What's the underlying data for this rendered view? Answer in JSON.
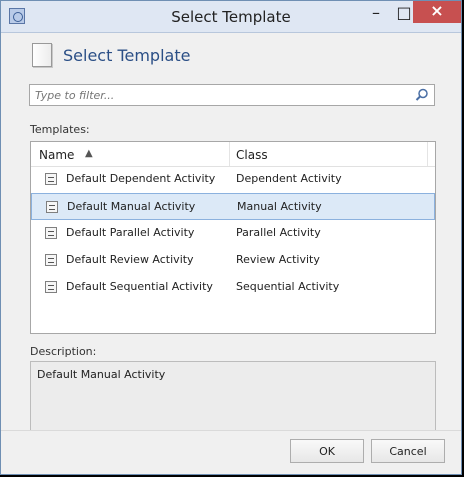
{
  "window": {
    "title": "Select Template"
  },
  "header": {
    "title": "Select Template"
  },
  "filter": {
    "placeholder": "Type to filter...",
    "value": ""
  },
  "templates": {
    "label": "Templates:",
    "columns": [
      "Name",
      "Class"
    ],
    "rows": [
      {
        "name": "Default Dependent Activity",
        "class": "Dependent Activity"
      },
      {
        "name": "Default Manual Activity",
        "class": "Manual Activity",
        "selected": true
      },
      {
        "name": "Default Parallel Activity",
        "class": "Parallel Activity"
      },
      {
        "name": "Default Review Activity",
        "class": "Review Activity"
      },
      {
        "name": "Default Sequential Activity",
        "class": "Sequential Activity"
      }
    ]
  },
  "description": {
    "label": "Description:",
    "text": "Default Manual Activity"
  },
  "buttons": {
    "ok": "OK",
    "cancel": "Cancel"
  },
  "icons": {
    "app": "template-icon",
    "search": "search-icon",
    "sort": "sort-up-icon",
    "row": "document-icon"
  }
}
